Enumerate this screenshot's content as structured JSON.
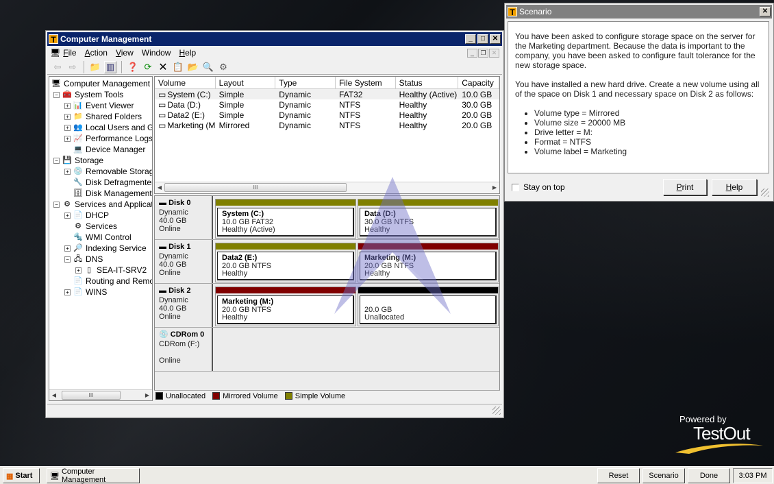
{
  "computer_management": {
    "title": "Computer Management",
    "menu": [
      {
        "label": "File",
        "accel": "F",
        "rest": "ile"
      },
      {
        "label": "Action",
        "accel": "A",
        "rest": "ction"
      },
      {
        "label": "View",
        "accel": "V",
        "rest": "iew"
      },
      {
        "label": "Window",
        "accel": "",
        "rest": "Window"
      },
      {
        "label": "Help",
        "accel": "H",
        "rest": "elp"
      }
    ],
    "toolbar": [
      "back-arrow",
      "forward-arrow",
      "up-one-level",
      "show-hide-console-tree",
      "help",
      "refresh",
      "delete",
      "properties",
      "open",
      "search",
      "settings"
    ],
    "tree": [
      {
        "label": "Computer Management (L",
        "level": 0,
        "expander": "",
        "icon": "computer"
      },
      {
        "label": "System Tools",
        "level": 1,
        "expander": "-",
        "icon": "tools"
      },
      {
        "label": "Event Viewer",
        "level": 2,
        "expander": "+",
        "icon": "event-viewer"
      },
      {
        "label": "Shared Folders",
        "level": 2,
        "expander": "+",
        "icon": "shared-folders"
      },
      {
        "label": "Local Users and Gr",
        "level": 2,
        "expander": "+",
        "icon": "users"
      },
      {
        "label": "Performance Logs",
        "level": 2,
        "expander": "+",
        "icon": "performance"
      },
      {
        "label": "Device Manager",
        "level": 2,
        "expander": "",
        "icon": "device-manager"
      },
      {
        "label": "Storage",
        "level": 1,
        "expander": "-",
        "icon": "storage"
      },
      {
        "label": "Removable Storage",
        "level": 2,
        "expander": "+",
        "icon": "removable-storage"
      },
      {
        "label": "Disk Defragmenter",
        "level": 2,
        "expander": "",
        "icon": "defragmenter"
      },
      {
        "label": "Disk Management",
        "level": 2,
        "expander": "",
        "icon": "disk-management"
      },
      {
        "label": "Services and Applicatio",
        "level": 1,
        "expander": "-",
        "icon": "services-apps"
      },
      {
        "label": "DHCP",
        "level": 2,
        "expander": "+",
        "icon": "dhcp"
      },
      {
        "label": "Services",
        "level": 2,
        "expander": "",
        "icon": "services"
      },
      {
        "label": "WMI Control",
        "level": 2,
        "expander": "",
        "icon": "wmi"
      },
      {
        "label": "Indexing Service",
        "level": 2,
        "expander": "+",
        "icon": "indexing"
      },
      {
        "label": "DNS",
        "level": 2,
        "expander": "-",
        "icon": "dns"
      },
      {
        "label": "SEA-IT-SRV2",
        "level": 3,
        "expander": "+",
        "icon": "server"
      },
      {
        "label": "Routing and Remot",
        "level": 2,
        "expander": "",
        "icon": "routing"
      },
      {
        "label": "WINS",
        "level": 2,
        "expander": "+",
        "icon": "wins"
      }
    ],
    "volume_list": {
      "columns": [
        "Volume",
        "Layout",
        "Type",
        "File System",
        "Status",
        "Capacity"
      ],
      "rows": [
        [
          "System (C:)",
          "Simple",
          "Dynamic",
          "FAT32",
          "Healthy (Active)",
          "10.0 GB"
        ],
        [
          "Data (D:)",
          "Simple",
          "Dynamic",
          "NTFS",
          "Healthy",
          "30.0 GB"
        ],
        [
          "Data2 (E:)",
          "Simple",
          "Dynamic",
          "NTFS",
          "Healthy",
          "20.0 GB"
        ],
        [
          "Marketing (M:)",
          "Mirrored",
          "Dynamic",
          "NTFS",
          "Healthy",
          "20.0 GB"
        ]
      ]
    },
    "disks": [
      {
        "name": "Disk 0",
        "type": "Dynamic",
        "size": "40.0 GB",
        "state": "Online",
        "partitions": [
          {
            "name": "System (C:)",
            "line2": "10.0 GB FAT32",
            "line3": "Healthy (Active)",
            "kind": "simple"
          },
          {
            "name": "Data (D:)",
            "line2": "30.0 GB NTFS",
            "line3": "Healthy",
            "kind": "simple"
          }
        ]
      },
      {
        "name": "Disk 1",
        "type": "Dynamic",
        "size": "40.0 GB",
        "state": "Online",
        "partitions": [
          {
            "name": "Data2 (E:)",
            "line2": "20.0 GB NTFS",
            "line3": "Healthy",
            "kind": "simple"
          },
          {
            "name": "Marketing (M:)",
            "line2": "20.0 GB NTFS",
            "line3": "Healthy",
            "kind": "mirrored"
          }
        ]
      },
      {
        "name": "Disk 2",
        "type": "Dynamic",
        "size": "40.0 GB",
        "state": "Online",
        "partitions": [
          {
            "name": "Marketing (M:)",
            "line2": "20.0 GB NTFS",
            "line3": "Healthy",
            "kind": "mirrored"
          },
          {
            "name": "",
            "line2": "20.0 GB",
            "line3": "Unallocated",
            "kind": "unallocated"
          }
        ]
      },
      {
        "name": "CDRom 0",
        "type": "CDRom (F:)",
        "size": "",
        "state": "Online",
        "partitions": []
      }
    ],
    "legend": [
      {
        "label": "Unallocated",
        "color": "#000000"
      },
      {
        "label": "Mirrored Volume",
        "color": "#800000"
      },
      {
        "label": "Simple Volume",
        "color": "#808000"
      }
    ],
    "colors": {
      "simple": "#808000",
      "mirrored": "#800000",
      "unallocated": "#000000",
      "titlebar": "#0a246a"
    }
  },
  "scenario": {
    "title": "Scenario",
    "paragraphs": [
      "You have been asked to configure storage space on the server for the Marketing department. Because the data is important to the company, you have been asked to configure fault tolerance for the new storage space.",
      "You have installed a new hard drive. Create a new volume using all of the space on Disk 1 and necessary space on Disk 2 as follows:"
    ],
    "bullets": [
      "Volume type = Mirrored",
      "Volume size = 20000 MB",
      "Drive letter = M:",
      "Format = NTFS",
      "Volume label = Marketing"
    ],
    "stay_on_top_label": "Stay on top",
    "stay_on_top_checked": false,
    "print_label": "Print",
    "help_label": "Help"
  },
  "branding": {
    "powered_by": "Powered by",
    "name": "TestOut"
  },
  "taskbar": {
    "start_label": "Start",
    "task_label": "Computer Management",
    "reset_label": "Reset",
    "scenario_label": "Scenario",
    "done_label": "Done",
    "clock": "3:03 PM"
  }
}
